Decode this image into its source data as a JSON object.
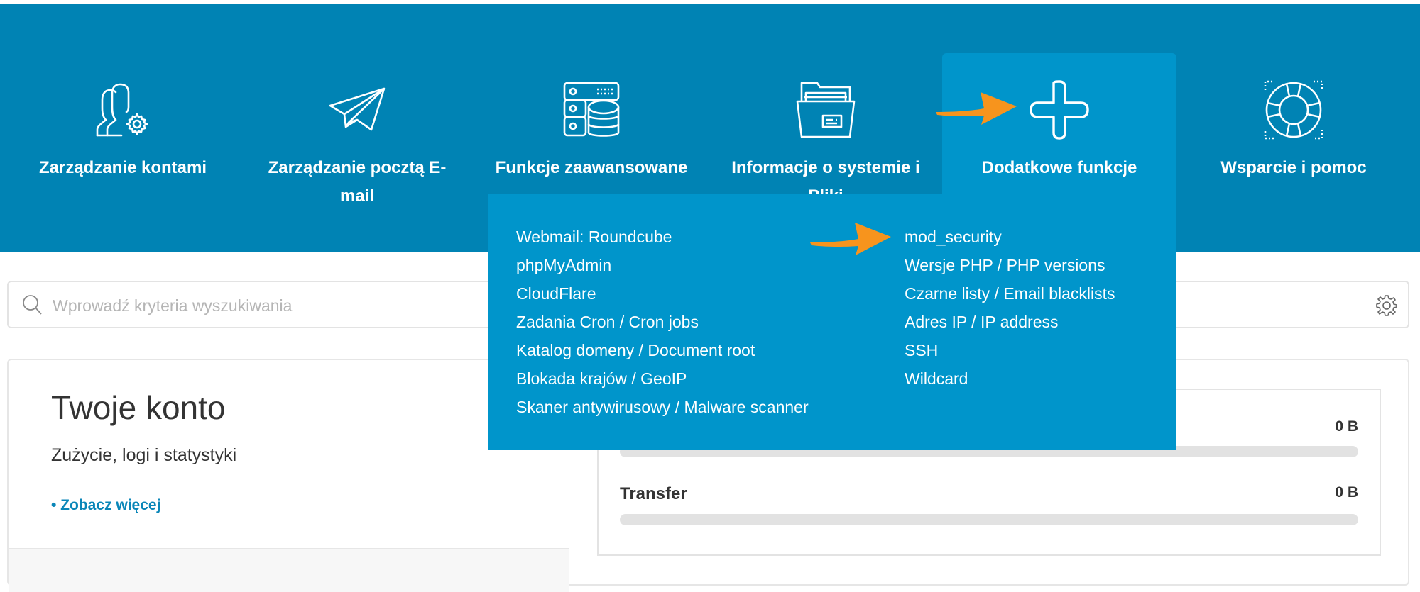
{
  "header": {
    "nav": [
      {
        "label": "Zarządzanie kontami",
        "icon": "users-gear-icon",
        "active": false
      },
      {
        "label": "Zarządzanie pocztą E-mail",
        "icon": "paper-plane-icon",
        "active": false
      },
      {
        "label": "Funkcje zaawansowane",
        "icon": "server-database-icon",
        "active": false
      },
      {
        "label": "Informacje o systemie i Pliki",
        "icon": "folder-files-icon",
        "active": false
      },
      {
        "label": "Dodatkowe funkcje",
        "icon": "plus-icon",
        "active": true
      },
      {
        "label": "Wsparcie i pomoc",
        "icon": "lifebuoy-icon",
        "active": false
      }
    ]
  },
  "dropdown": {
    "left_items": [
      "Webmail: Roundcube",
      "phpMyAdmin",
      "CloudFlare",
      "Zadania Cron / Cron jobs",
      "Katalog domeny / Document root",
      "Blokada krajów / GeoIP",
      "Skaner antywirusowy / Malware scanner"
    ],
    "right_items": [
      "mod_security",
      "Wersje PHP / PHP versions",
      "Czarne listy / Email blacklists",
      "Adres IP / IP address",
      "SSH",
      "Wildcard"
    ]
  },
  "annotations": {
    "arrow_color": "#f7941d",
    "targets": [
      "Dodatkowe funkcje",
      "mod_security"
    ]
  },
  "search": {
    "placeholder": "Wprowadź kryteria wyszukiwania",
    "value": ""
  },
  "account_card": {
    "title": "Twoje konto",
    "subtitle": "Zużycie, logi i statystyki",
    "link": "• Zobacz więcej",
    "usage": [
      {
        "label": "",
        "value": "0 B",
        "progress": 0
      },
      {
        "label": "Transfer",
        "value": "0 B",
        "progress": 0
      }
    ]
  },
  "colors": {
    "header_bg": "#0083b4",
    "active_bg": "#0095cb",
    "link": "#0a86b8",
    "arrow": "#f7941d"
  }
}
